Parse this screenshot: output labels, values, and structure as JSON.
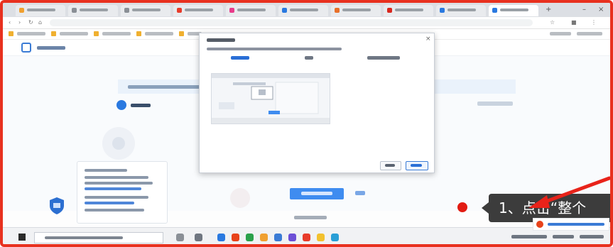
{
  "callout": {
    "text": "1、点击“整个"
  },
  "colors": {
    "frame": "#e8311f",
    "accent": "#2a79e0",
    "marker": "#e21b12",
    "callout_bg": "#3c3c3c"
  },
  "icons": [
    "logo-icon",
    "shield-icon",
    "windows-start-icon",
    "search-icon",
    "close-icon",
    "red-arrow-icon"
  ]
}
